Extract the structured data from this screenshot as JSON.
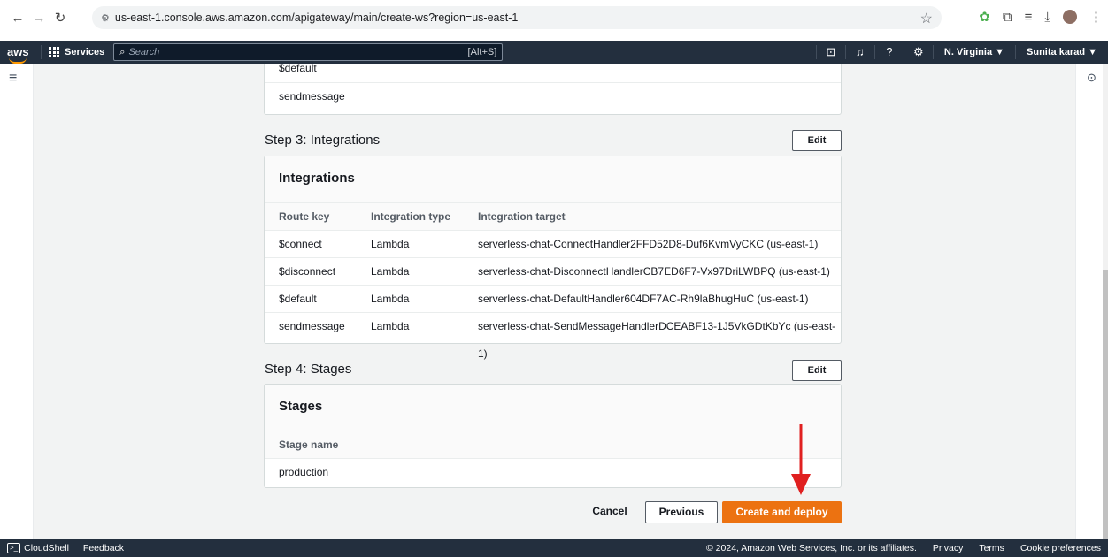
{
  "browser": {
    "url": "us-east-1.console.aws.amazon.com/apigateway/main/create-ws?region=us-east-1",
    "icons": [
      "back-icon",
      "forward-icon",
      "reload-icon",
      "site-info-icon",
      "star-icon",
      "extension-icon",
      "puzzle-icon",
      "reading-list-icon",
      "download-icon",
      "profile-avatar",
      "more-icon"
    ]
  },
  "aws_nav": {
    "logo": "aws",
    "services_label": "Services",
    "search_placeholder": "Search",
    "search_shortcut": "[Alt+S]",
    "region": "N. Virginia ▼",
    "user": "Sunita karad ▼"
  },
  "step2_routes": [
    "$default",
    "sendmessage"
  ],
  "step3": {
    "title": "Step 3: Integrations",
    "edit_label": "Edit",
    "card_title": "Integrations",
    "columns": [
      "Route key",
      "Integration type",
      "Integration target"
    ],
    "rows": [
      [
        "$connect",
        "Lambda",
        "serverless-chat-ConnectHandler2FFD52D8-Duf6KvmVyCKC (us-east-1)"
      ],
      [
        "$disconnect",
        "Lambda",
        "serverless-chat-DisconnectHandlerCB7ED6F7-Vx97DriLWBPQ (us-east-1)"
      ],
      [
        "$default",
        "Lambda",
        "serverless-chat-DefaultHandler604DF7AC-Rh9laBhugHuC (us-east-1)"
      ],
      [
        "sendmessage",
        "Lambda",
        "serverless-chat-SendMessageHandlerDCEABF13-1J5VkGDtKbYc (us-east-1)"
      ]
    ]
  },
  "step4": {
    "title": "Step 4: Stages",
    "edit_label": "Edit",
    "card_title": "Stages",
    "column": "Stage name",
    "rows": [
      "production"
    ]
  },
  "actions": {
    "cancel": "Cancel",
    "previous": "Previous",
    "create": "Create and deploy"
  },
  "footer": {
    "cloudshell": "CloudShell",
    "feedback": "Feedback",
    "copyright": "© 2024, Amazon Web Services, Inc. or its affiliates.",
    "privacy": "Privacy",
    "terms": "Terms",
    "cookie": "Cookie preferences"
  },
  "colors": {
    "primary_button": "#ec7211",
    "nav_bg": "#232f3e",
    "annotation_arrow": "#e02020"
  }
}
